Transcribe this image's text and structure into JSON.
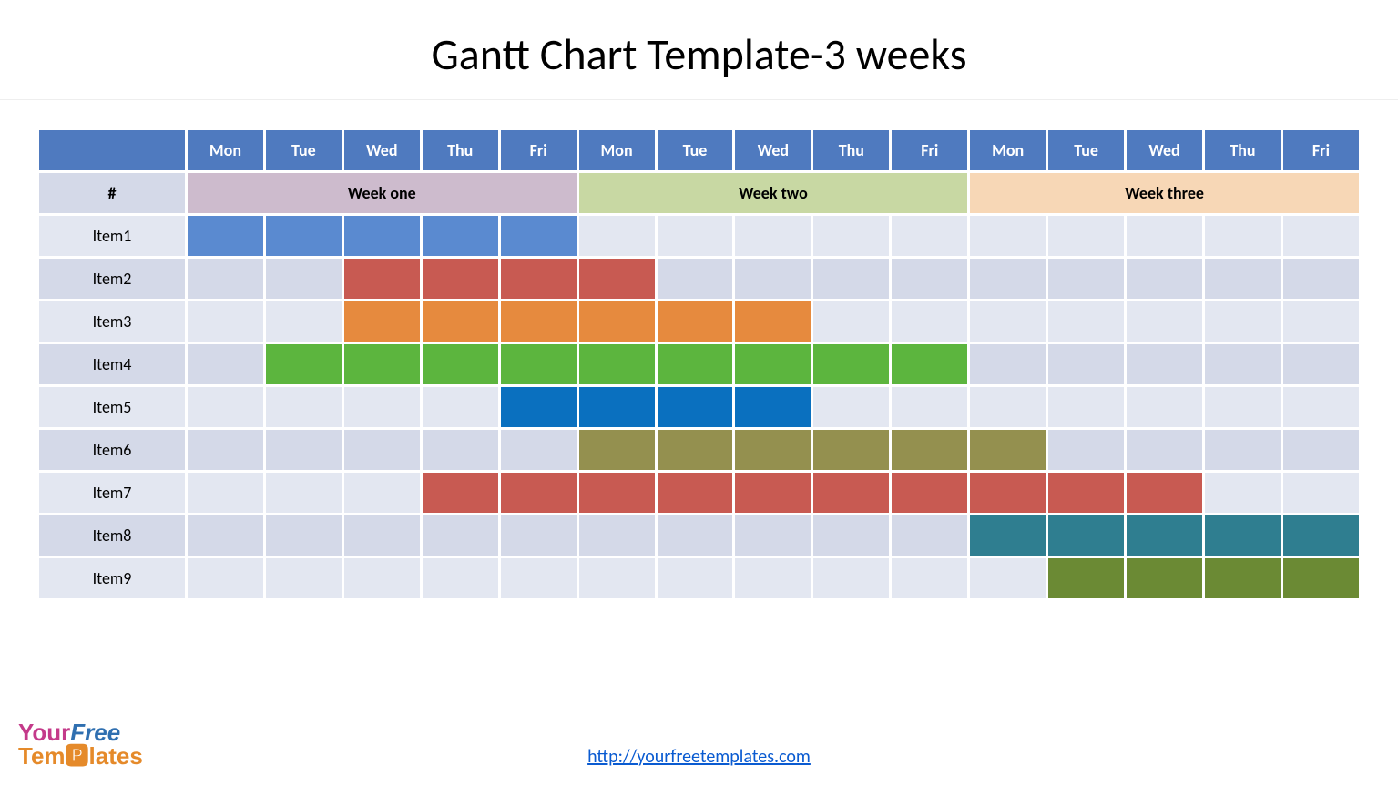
{
  "title": "Gantt Chart Template-3 weeks",
  "hash_label": "#",
  "days": [
    "Mon",
    "Tue",
    "Wed",
    "Thu",
    "Fri",
    "Mon",
    "Tue",
    "Wed",
    "Thu",
    "Fri",
    "Mon",
    "Tue",
    "Wed",
    "Thu",
    "Fri"
  ],
  "weeks": [
    {
      "label": "Week one",
      "span": 5,
      "class": "week-one"
    },
    {
      "label": "Week two",
      "span": 5,
      "class": "week-two"
    },
    {
      "label": "Week three",
      "span": 5,
      "class": "week-three"
    }
  ],
  "items": [
    {
      "label": "Item1",
      "start": 1,
      "end": 5,
      "color": "bar-1"
    },
    {
      "label": "Item2",
      "start": 3,
      "end": 6,
      "color": "bar-2"
    },
    {
      "label": "Item3",
      "start": 3,
      "end": 8,
      "color": "bar-3"
    },
    {
      "label": "Item4",
      "start": 2,
      "end": 10,
      "color": "bar-4"
    },
    {
      "label": "Item5",
      "start": 5,
      "end": 8,
      "color": "bar-5"
    },
    {
      "label": "Item6",
      "start": 6,
      "end": 11,
      "color": "bar-6"
    },
    {
      "label": "Item7",
      "start": 4,
      "end": 13,
      "color": "bar-7"
    },
    {
      "label": "Item8",
      "start": 11,
      "end": 15,
      "color": "bar-8"
    },
    {
      "label": "Item9",
      "start": 12,
      "end": 15,
      "color": "bar-9"
    }
  ],
  "footer_url_text": "http://yourfreetemplates.com",
  "footer_url": "http://yourfreetemplates.com",
  "logo": {
    "your": "Your",
    "free": "Free",
    "templates": "Tem🅿lates"
  },
  "chart_data": {
    "type": "gantt",
    "title": "Gantt Chart Template-3 weeks",
    "x_categories": [
      "Mon",
      "Tue",
      "Wed",
      "Thu",
      "Fri",
      "Mon",
      "Tue",
      "Wed",
      "Thu",
      "Fri",
      "Mon",
      "Tue",
      "Wed",
      "Thu",
      "Fri"
    ],
    "x_groups": [
      "Week one",
      "Week one",
      "Week one",
      "Week one",
      "Week one",
      "Week two",
      "Week two",
      "Week two",
      "Week two",
      "Week two",
      "Week three",
      "Week three",
      "Week three",
      "Week three",
      "Week three"
    ],
    "tasks": [
      {
        "name": "Item1",
        "start": 1,
        "end": 5,
        "color": "#5a8ad0"
      },
      {
        "name": "Item2",
        "start": 3,
        "end": 6,
        "color": "#c85a52"
      },
      {
        "name": "Item3",
        "start": 3,
        "end": 8,
        "color": "#e68a3e"
      },
      {
        "name": "Item4",
        "start": 2,
        "end": 10,
        "color": "#5cb53e"
      },
      {
        "name": "Item5",
        "start": 5,
        "end": 8,
        "color": "#0a70bf"
      },
      {
        "name": "Item6",
        "start": 6,
        "end": 11,
        "color": "#94904f"
      },
      {
        "name": "Item7",
        "start": 4,
        "end": 13,
        "color": "#c85a52"
      },
      {
        "name": "Item8",
        "start": 11,
        "end": 15,
        "color": "#2f7e90"
      },
      {
        "name": "Item9",
        "start": 12,
        "end": 15,
        "color": "#6b8a34"
      }
    ]
  }
}
